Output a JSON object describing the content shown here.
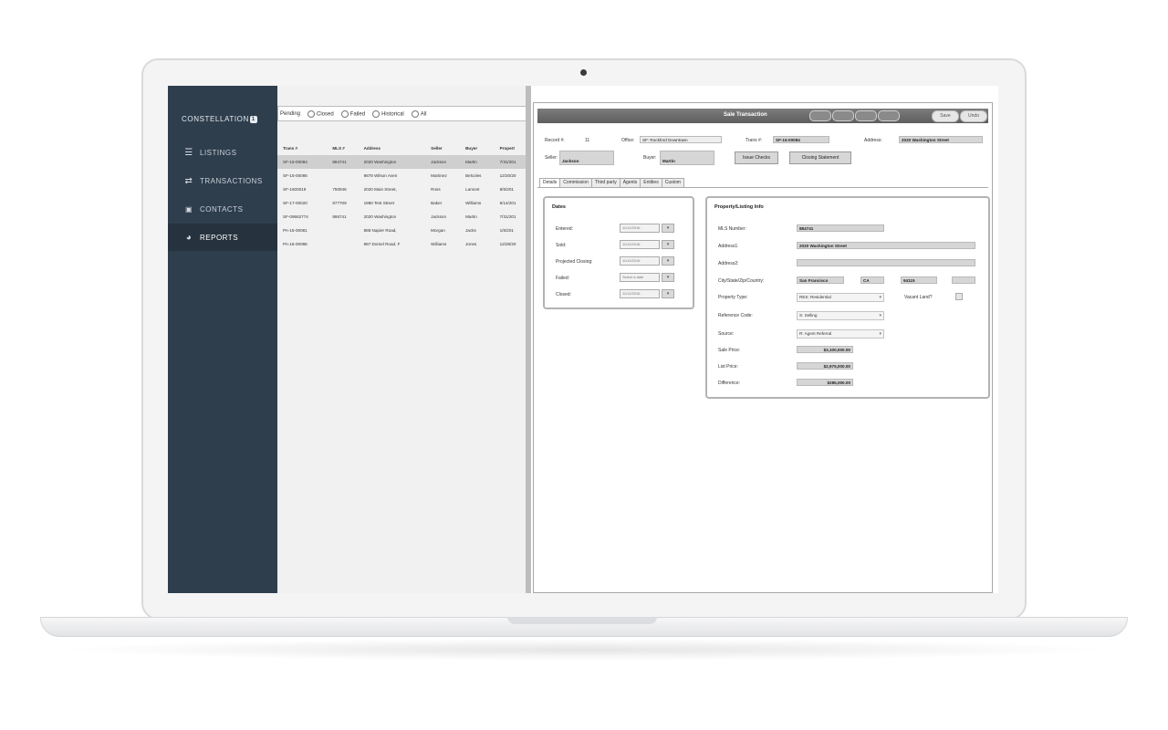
{
  "sidebar": {
    "brand": "CONSTELLATION",
    "brand_badge": "1",
    "items": [
      {
        "label": "LISTINGS",
        "icon": "list-icon"
      },
      {
        "label": "TRANSACTIONS",
        "icon": "swap-arrows-icon"
      },
      {
        "label": "CONTACTS",
        "icon": "contact-card-icon"
      },
      {
        "label": "REPORTS",
        "icon": "pie-chart-icon"
      }
    ],
    "active": "REPORTS"
  },
  "list": {
    "filters": [
      "Pending",
      "Closed",
      "Failed",
      "Historical",
      "All"
    ],
    "columns": [
      "Trans #",
      "MLS #",
      "Address",
      "Seller",
      "Buyer",
      "Propert"
    ],
    "rows": [
      [
        "SF-15-00084",
        "884741",
        "2020 Washington",
        "Jackson",
        "Martin",
        "7/31/201"
      ],
      [
        "SF-15-00086",
        "",
        "9878 Wilson Aven",
        "Martinez",
        "Belcoles",
        "12/20/20"
      ],
      [
        "SF-1600019",
        "750946",
        "2020 Main Street,",
        "Ross",
        "Lamont",
        "8/6/201"
      ],
      [
        "SF-17-00020",
        "877709",
        "1980 Test Street",
        "Baker",
        "Williams",
        "6/14/201"
      ],
      [
        "SF-09662774",
        "866741",
        "2020 Washington",
        "Jackson",
        "Martin",
        "7/31/201"
      ],
      [
        "PA-15-00081",
        "",
        "888 Napier Road,",
        "Morgan",
        "Jacks",
        "1/6/201"
      ],
      [
        "PA-15-00088",
        "",
        "987 Dorsel Road, F",
        "Williams",
        "Jones",
        "12/28/20"
      ]
    ]
  },
  "detail": {
    "title": "Sale Transaction",
    "actions": [
      "Save",
      "Undo"
    ],
    "record_label": "Record #:",
    "record_value": "11",
    "office_label": "Office:",
    "office_value": "SF: Rockford Downtown",
    "trans_label": "Trans #:",
    "trans_value": "SF-15-00084",
    "address_label": "Address:",
    "address_value": "2020 Washington Street",
    "seller_label": "Seller:",
    "seller_value": "Jackson",
    "buyer_label": "Buyer:",
    "buyer_value": "Martin",
    "issue_checks": "Issue Checks",
    "closing_statement": "Closing Statement",
    "tabs": [
      "Details",
      "Commission",
      "Third party",
      "Agents",
      "Entities",
      "Custom"
    ],
    "dates": {
      "title": "Dates",
      "rows": [
        {
          "label": "Entered:",
          "value": "11/11/2016"
        },
        {
          "label": "Sold:",
          "value": "11/11/2016"
        },
        {
          "label": "Projected Closing:",
          "value": "11/11/2016"
        },
        {
          "label": "Failed:",
          "value": "Select a date"
        },
        {
          "label": "Closed:",
          "value": "11/11/2016"
        }
      ]
    },
    "property": {
      "title": "Property/Listing Info",
      "mls_label": "MLS Number:",
      "mls_value": "884741",
      "address1_label": "Address1:",
      "address1_value": "2020 Washington Street",
      "address2_label": "Address2:",
      "address2_value": "",
      "city_label": "City/State/Zip/Country:",
      "city_value": "San Francisco",
      "state_value": "CA",
      "zip_value": "94115",
      "country_value": "",
      "ptype_label": "Property Type:",
      "ptype_value": "RES: Residential",
      "vacant_label": "Vacant Land?",
      "ref_label": "Reference Code:",
      "ref_value": "S: Selling",
      "source_label": "Source:",
      "source_value": "R: Agent Referral",
      "sale_label": "Sale Price:",
      "sale_value": "$3,100,000.00",
      "list_label": "List Price:",
      "list_value": "$2,975,000.00",
      "diff_label": "Difference:",
      "diff_value": "$285,000.00"
    }
  }
}
